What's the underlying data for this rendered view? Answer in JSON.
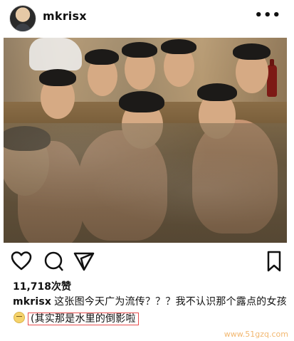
{
  "post": {
    "username": "mkrisx",
    "more_label": "•••"
  },
  "likes": "11,718次赞",
  "caption": {
    "user": "mkrisx",
    "text1": "这张图今天广为流传？？？我不认识那个露点的女孩",
    "highlight": "(其实那是水里的倒影啦"
  },
  "watermark": "www.51gzq.com",
  "icons": {
    "like": "heart-icon",
    "comment": "comment-icon",
    "share": "share-icon",
    "save": "bookmark-icon"
  }
}
